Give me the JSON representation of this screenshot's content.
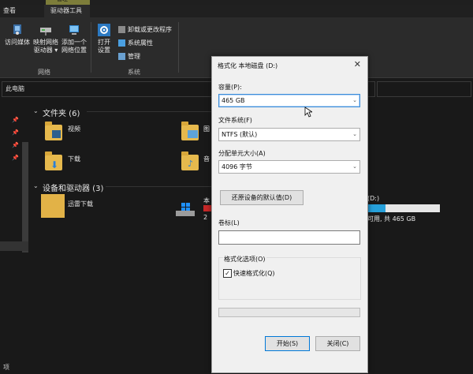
{
  "ribbon": {
    "context_tab": "管理",
    "tabs": [
      "查看",
      "驱动器工具"
    ],
    "network_group": {
      "label": "网络",
      "buttons": [
        {
          "line1": "访问媒体",
          "line2": ""
        },
        {
          "line1": "映射网络",
          "line2": "驱动器 ▾"
        },
        {
          "line1": "添加一个",
          "line2": "网络位置"
        }
      ]
    },
    "system_group": {
      "label": "系统",
      "open_settings": {
        "line1": "打开",
        "line2": "设置"
      },
      "items": [
        "卸载或更改程序",
        "系统属性",
        "管理"
      ]
    }
  },
  "address": {
    "location": "此电脑"
  },
  "content": {
    "folders_header": "文件夹 (6)",
    "folders": [
      "视频",
      "图",
      "下载",
      "音"
    ],
    "devices_header": "设备和驱动器 (3)",
    "devices": [
      "迅雷下载"
    ],
    "drive_c": {
      "name": "本",
      "info": "2"
    },
    "drive_d": {
      "name": "(D:)",
      "info": "可用, 共 465 GB",
      "used_fraction": 0.32
    }
  },
  "dialog": {
    "title": "格式化 本地磁盘 (D:)",
    "close": "✕",
    "capacity_label": "容量(P):",
    "capacity_value": "465 GB",
    "filesystem_label": "文件系统(F)",
    "filesystem_value": "NTFS (默认)",
    "alloc_label": "分配单元大小(A)",
    "alloc_value": "4096 字节",
    "restore_button": "还原设备的默认值(D)",
    "volume_label": "卷标(L)",
    "volume_value": "",
    "options_label": "格式化选项(O)",
    "quick_format": "快速格式化(Q)",
    "quick_checked": "✓",
    "start_button": "开始(S)",
    "close_button": "关闭(C)"
  },
  "status_bar": {
    "text": "项"
  }
}
